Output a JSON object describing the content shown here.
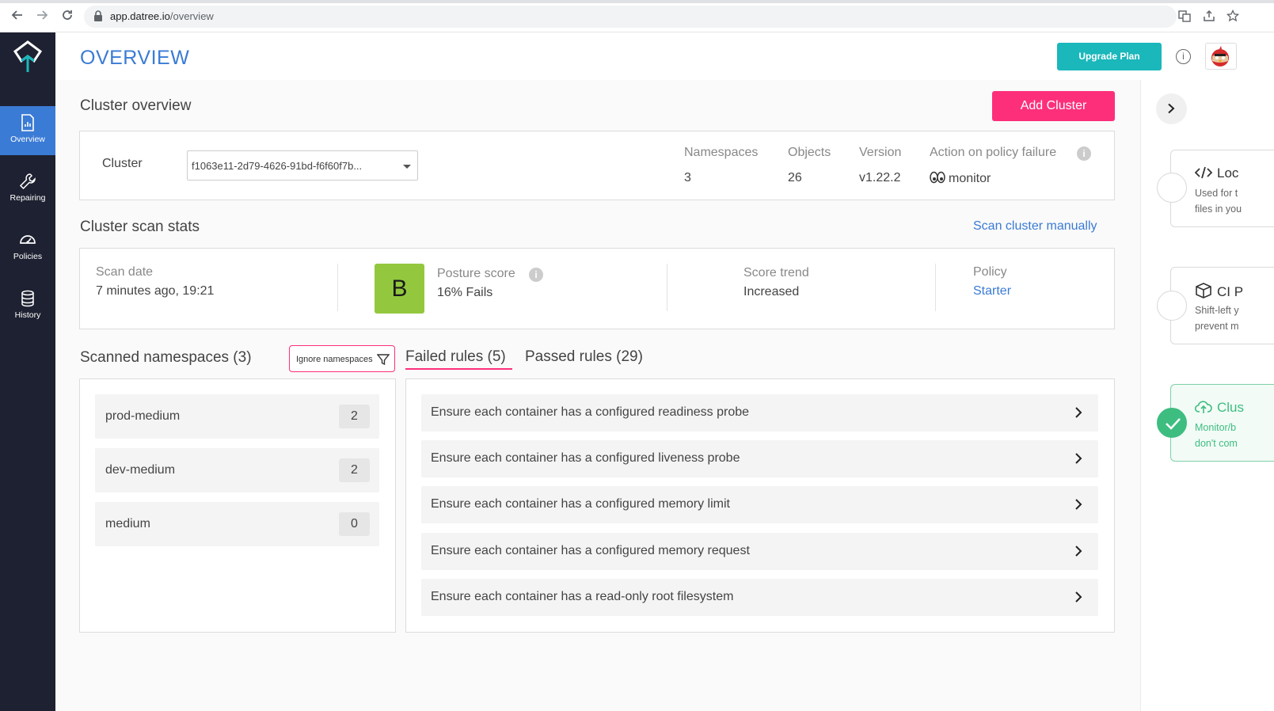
{
  "browser": {
    "url_host": "app.datree.io",
    "url_path": "/overview"
  },
  "sidebar": {
    "items": [
      {
        "label": "Overview",
        "icon": "report-icon",
        "active": true
      },
      {
        "label": "Repairing",
        "icon": "wrench-icon",
        "active": false
      },
      {
        "label": "Policies",
        "icon": "gauge-icon",
        "active": false
      },
      {
        "label": "History",
        "icon": "database-icon",
        "active": false
      }
    ]
  },
  "header": {
    "title": "OVERVIEW",
    "upgrade_label": "Upgrade Plan",
    "info_glyph": "i"
  },
  "cluster_overview": {
    "title": "Cluster overview",
    "add_cluster_label": "Add Cluster",
    "cluster_label": "Cluster",
    "cluster_value": "f1063e11-2d79-4626-91bd-f6f60f7b...",
    "stats": {
      "namespaces_label": "Namespaces",
      "namespaces_value": "3",
      "objects_label": "Objects",
      "objects_value": "26",
      "version_label": "Version",
      "version_value": "v1.22.2",
      "action_label": "Action on policy failure",
      "action_value": "monitor"
    }
  },
  "scan_stats": {
    "title": "Cluster scan stats",
    "scan_manually_label": "Scan cluster manually",
    "scan_date_label": "Scan date",
    "scan_date_value": "7 minutes ago, 19:21",
    "grade": "B",
    "posture_label": "Posture score",
    "posture_value": "16% Fails",
    "trend_label": "Score trend",
    "trend_value": "Increased",
    "policy_label": "Policy",
    "policy_value": "Starter",
    "colors": {
      "grade_bg": "#93c83e",
      "accent": "#fd2f7b",
      "link": "#3a7bd5"
    }
  },
  "namespaces": {
    "title": "Scanned namespaces (3)",
    "ignore_label": "Ignore namespaces",
    "items": [
      {
        "name": "prod-medium",
        "count": "2"
      },
      {
        "name": "dev-medium",
        "count": "2"
      },
      {
        "name": "medium",
        "count": "0"
      }
    ]
  },
  "rules": {
    "tabs": [
      {
        "label": "Failed rules (5)",
        "active": true
      },
      {
        "label": "Passed rules (29)",
        "active": false
      }
    ],
    "failed": [
      "Ensure each container has a configured readiness probe",
      "Ensure each container has a configured liveness probe",
      "Ensure each container has a configured memory limit",
      "Ensure each container has a configured memory request",
      "Ensure each container has a read-only root filesystem"
    ]
  },
  "right_panel": {
    "steps": [
      {
        "title": "Loc",
        "desc1": "Used for t",
        "desc2": "files in you",
        "done": false
      },
      {
        "title": "CI P",
        "desc1": "Shift-left y",
        "desc2": "prevent m",
        "done": false
      },
      {
        "title": "Clus",
        "desc1": "Monitor/b",
        "desc2": "don't com",
        "done": true
      }
    ]
  }
}
